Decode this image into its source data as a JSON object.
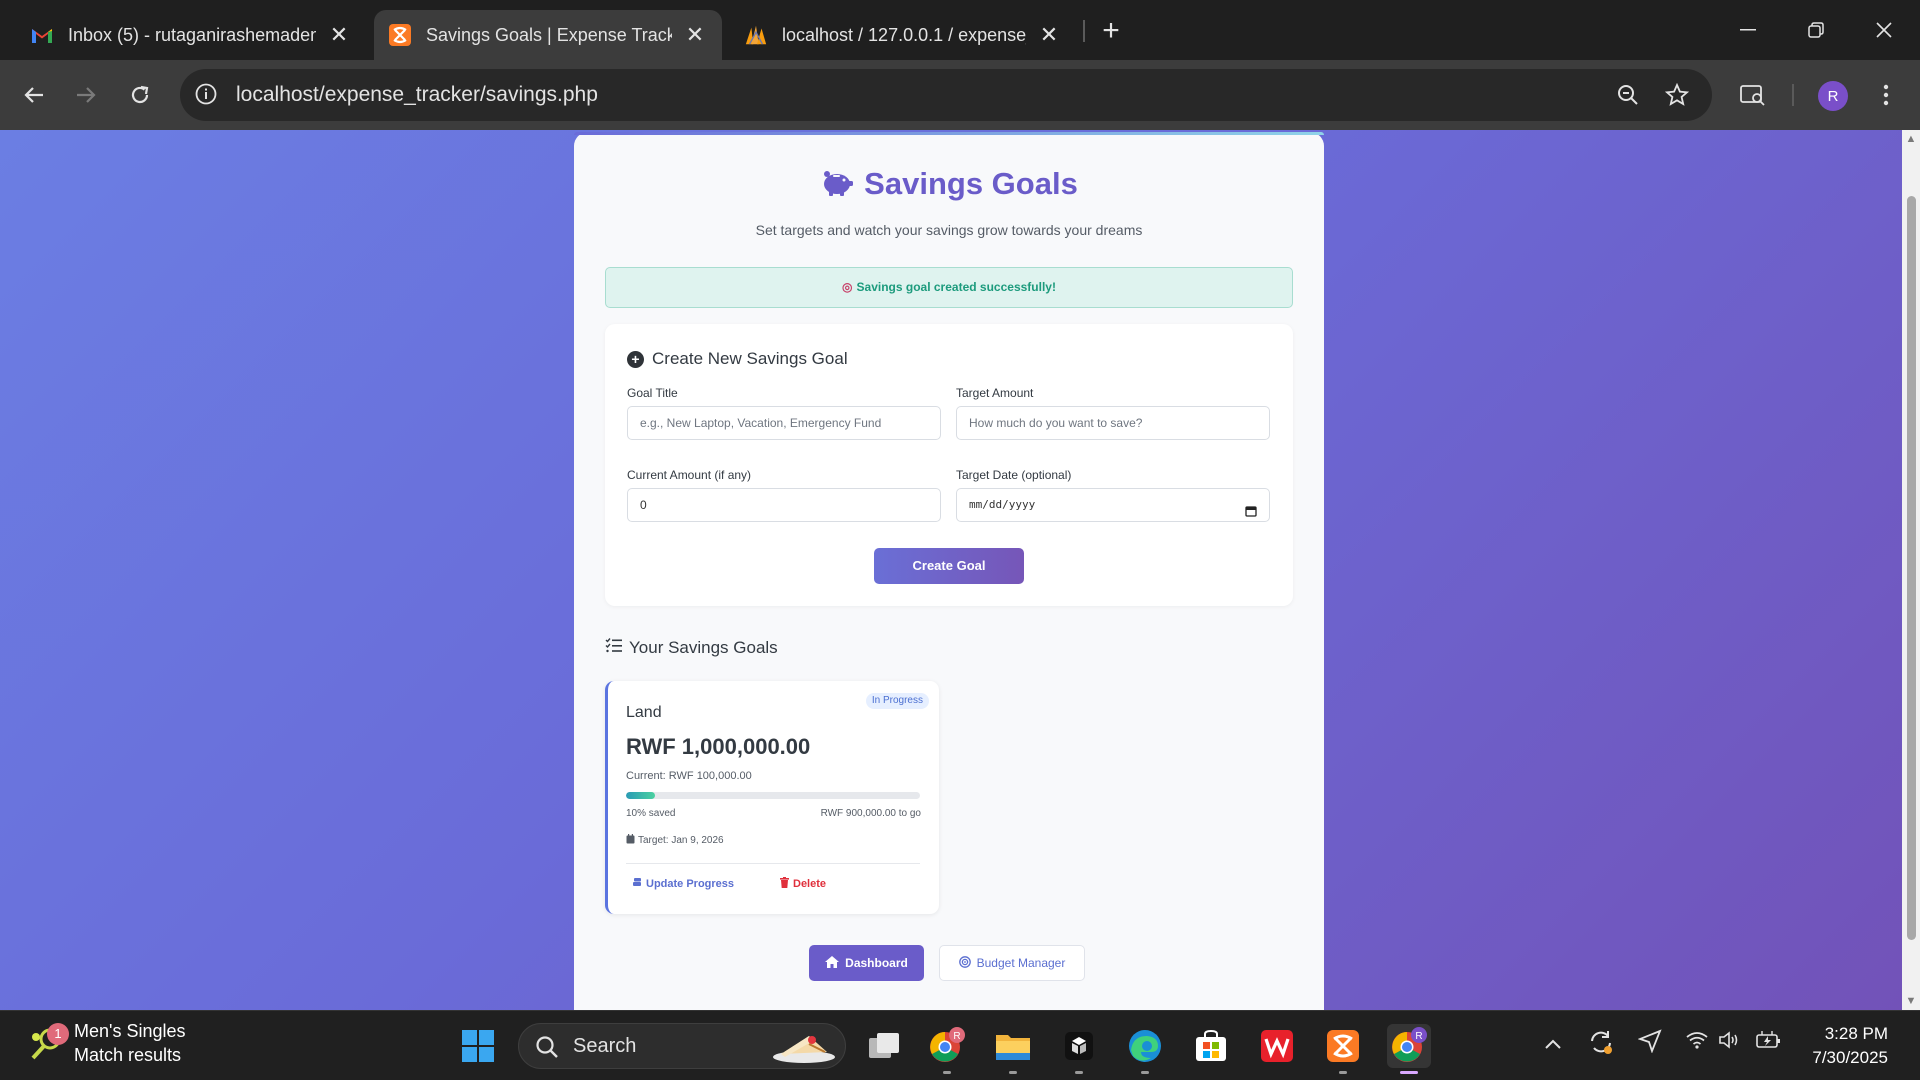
{
  "browser": {
    "tabs": [
      {
        "title": "Inbox (5) - rutaganirashemadem",
        "favicon": "gmail-icon"
      },
      {
        "title": "Savings Goals | Expense Tracker",
        "favicon": "xampp-icon"
      },
      {
        "title": "localhost / 127.0.0.1 / expense_t",
        "favicon": "phpmyadmin-icon"
      }
    ],
    "url": "localhost/expense_tracker/savings.php",
    "profile_initial": "R"
  },
  "page": {
    "title": "Savings Goals",
    "subtitle": "Set targets and watch your savings grow towards your dreams",
    "alert": "Savings goal created successfully!",
    "alert_emoji": "◎",
    "form": {
      "heading": "Create New Savings Goal",
      "goal_title_label": "Goal Title",
      "goal_title_placeholder": "e.g., New Laptop, Vacation, Emergency Fund",
      "target_amount_label": "Target Amount",
      "target_amount_placeholder": "How much do you want to save?",
      "current_amount_label": "Current Amount (if any)",
      "current_amount_value": "0",
      "target_date_label": "Target Date (optional)",
      "target_date_placeholder": "mm/dd/yyyy",
      "submit_label": "Create Goal"
    },
    "goals_heading": "Your Savings Goals",
    "goals": [
      {
        "title": "Land",
        "status": "In Progress",
        "target": "RWF 1,000,000.00",
        "current": "Current: RWF 100,000.00",
        "progress": 0.1,
        "saved_text": "10% saved",
        "remaining_text": "RWF 900,000.00 to go",
        "target_date": "Target: Jan 9, 2026",
        "update_label": "Update Progress",
        "delete_label": "Delete"
      }
    ],
    "nav": {
      "dashboard_label": "Dashboard",
      "budget_label": "Budget Manager"
    }
  },
  "taskbar": {
    "widget_title": "Men's Singles",
    "widget_subtitle": "Match results",
    "widget_badge": "1",
    "search_label": "Search",
    "time": "3:28 PM",
    "date": "7/30/2025"
  }
}
